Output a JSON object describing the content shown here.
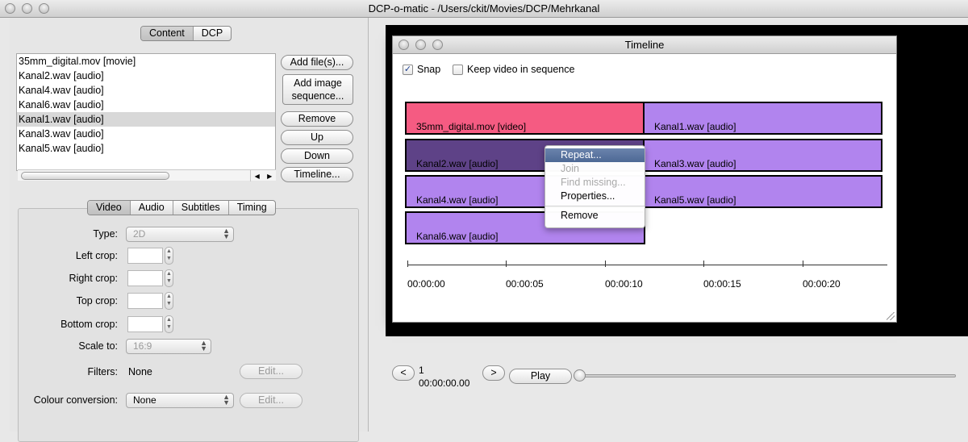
{
  "window": {
    "title": "DCP-o-matic - /Users/ckit/Movies/DCP/Mehrkanal"
  },
  "top_tabs": [
    "Content",
    "DCP"
  ],
  "content_list": [
    "35mm_digital.mov [movie]",
    "Kanal2.wav [audio]",
    "Kanal4.wav [audio]",
    "Kanal6.wav [audio]",
    "Kanal1.wav [audio]",
    "Kanal3.wav [audio]",
    "Kanal5.wav [audio]"
  ],
  "selected_content": "Kanal1.wav [audio]",
  "buttons": {
    "add_files": "Add file(s)...",
    "add_image_1": "Add image",
    "add_image_2": "sequence...",
    "remove": "Remove",
    "up": "Up",
    "down": "Down",
    "timeline": "Timeline..."
  },
  "sub_tabs": [
    "Video",
    "Audio",
    "Subtitles",
    "Timing"
  ],
  "video": {
    "type_label": "Type:",
    "type_value": "2D",
    "left_crop_label": "Left crop:",
    "right_crop_label": "Right crop:",
    "top_crop_label": "Top crop:",
    "bottom_crop_label": "Bottom crop:",
    "scale_label": "Scale to:",
    "scale_value": "16:9",
    "filters_label": "Filters:",
    "filters_value": "None",
    "filters_edit": "Edit...",
    "colour_label": "Colour conversion:",
    "colour_value": "None",
    "colour_edit": "Edit..."
  },
  "timeline": {
    "title": "Timeline",
    "snap_label": "Snap",
    "snap_checked": true,
    "keep_label": "Keep video in sequence",
    "keep_checked": false,
    "tracks": [
      {
        "label": "35mm_digital.mov [video]",
        "color": "#f55b82"
      },
      {
        "label": "Kanal1.wav [audio]",
        "color": "#b184ee"
      },
      {
        "label": "Kanal2.wav [audio]",
        "color": "#5e4287"
      },
      {
        "label": "Kanal3.wav [audio]",
        "color": "#b184ee"
      },
      {
        "label": "Kanal4.wav [audio]",
        "color": "#b184ee"
      },
      {
        "label": "Kanal5.wav [audio]",
        "color": "#b184ee"
      },
      {
        "label": "Kanal6.wav [audio]",
        "color": "#b184ee"
      }
    ],
    "time_labels": [
      "00:00:00",
      "00:00:05",
      "00:00:10",
      "00:00:15",
      "00:00:20"
    ]
  },
  "context_menu": {
    "repeat": "Repeat...",
    "join": "Join",
    "find_missing": "Find missing...",
    "properties": "Properties...",
    "remove": "Remove"
  },
  "playback": {
    "prev": "<",
    "next": ">",
    "frame": "1",
    "timecode": "00:00:00.00",
    "play": "Play",
    "position": 0.0
  }
}
